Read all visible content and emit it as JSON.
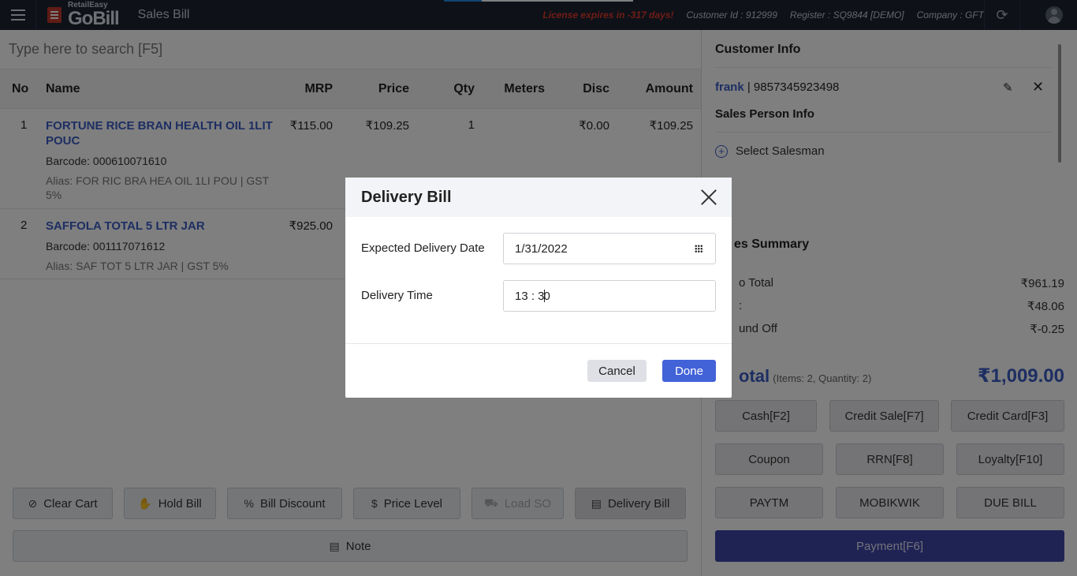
{
  "header": {
    "logo_small": "RetailEasy",
    "logo_big": "GoBill",
    "page_name": "Sales Bill",
    "license_text": "License expires in -317 days!",
    "customer_id": "Customer Id : 912999",
    "register": "Register : SQ9844 [DEMO]",
    "company": "Company : GFT"
  },
  "search": {
    "placeholder": "Type here to search [F5]"
  },
  "table": {
    "headers": {
      "no": "No",
      "name": "Name",
      "mrp": "MRP",
      "price": "Price",
      "qty": "Qty",
      "meters": "Meters",
      "disc": "Disc",
      "amount": "Amount"
    },
    "rows": [
      {
        "no": "1",
        "name": "FORTUNE RICE BRAN HEALTH OIL 1LIT POUC",
        "barcode": "Barcode: 000610071610",
        "alias": "Alias: FOR RIC BRA HEA OIL 1LI POU | GST 5%",
        "mrp": "₹115.00",
        "price": "₹109.25",
        "qty": "1",
        "meters": "",
        "disc": "₹0.00",
        "amount": "₹109.25"
      },
      {
        "no": "2",
        "name": "SAFFOLA TOTAL 5 LTR JAR",
        "barcode": "Barcode: 001117071612",
        "alias": "Alias: SAF TOT 5 LTR JAR | GST 5%",
        "mrp": "₹925.00",
        "price": "",
        "qty": "",
        "meters": "",
        "disc": "",
        "amount": ""
      }
    ]
  },
  "actions": {
    "clear_cart": "Clear Cart",
    "hold_bill": "Hold Bill",
    "bill_discount": "Bill Discount",
    "price_level": "Price Level",
    "load_so": "Load SO",
    "delivery_bill": "Delivery Bill",
    "note": "Note"
  },
  "customer": {
    "title": "Customer Info",
    "name": "frank",
    "phone": "| 9857345923498",
    "salesperson_title": "Sales Person Info",
    "select_salesman": "Select Salesman"
  },
  "summary": {
    "title": "es Summary",
    "subtotal_label": "o Total",
    "subtotal_value": "₹961.19",
    "tax_label": ":",
    "tax_value": "₹48.06",
    "roundoff_label": "und Off",
    "roundoff_value": "₹-0.25",
    "total_label": "otal",
    "total_meta": "(Items: 2, Quantity: 2)",
    "total_value": "₹1,009.00"
  },
  "payments": {
    "cash": "Cash[F2]",
    "credit_sale": "Credit Sale[F7]",
    "credit_card": "Credit Card[F3]",
    "coupon": "Coupon",
    "rrn": "RRN[F8]",
    "loyalty": "Loyalty[F10]",
    "paytm": "PAYTM",
    "mobikwik": "MOBIKWIK",
    "due_bill": "DUE BILL",
    "payment": "Payment[F6]"
  },
  "modal": {
    "title": "Delivery Bill",
    "date_label": "Expected Delivery Date",
    "date_value": "1/31/2022",
    "time_label": "Delivery Time",
    "time_before_caret": "13 : 3",
    "time_after_caret": "0",
    "cancel": "Cancel",
    "done": "Done"
  }
}
